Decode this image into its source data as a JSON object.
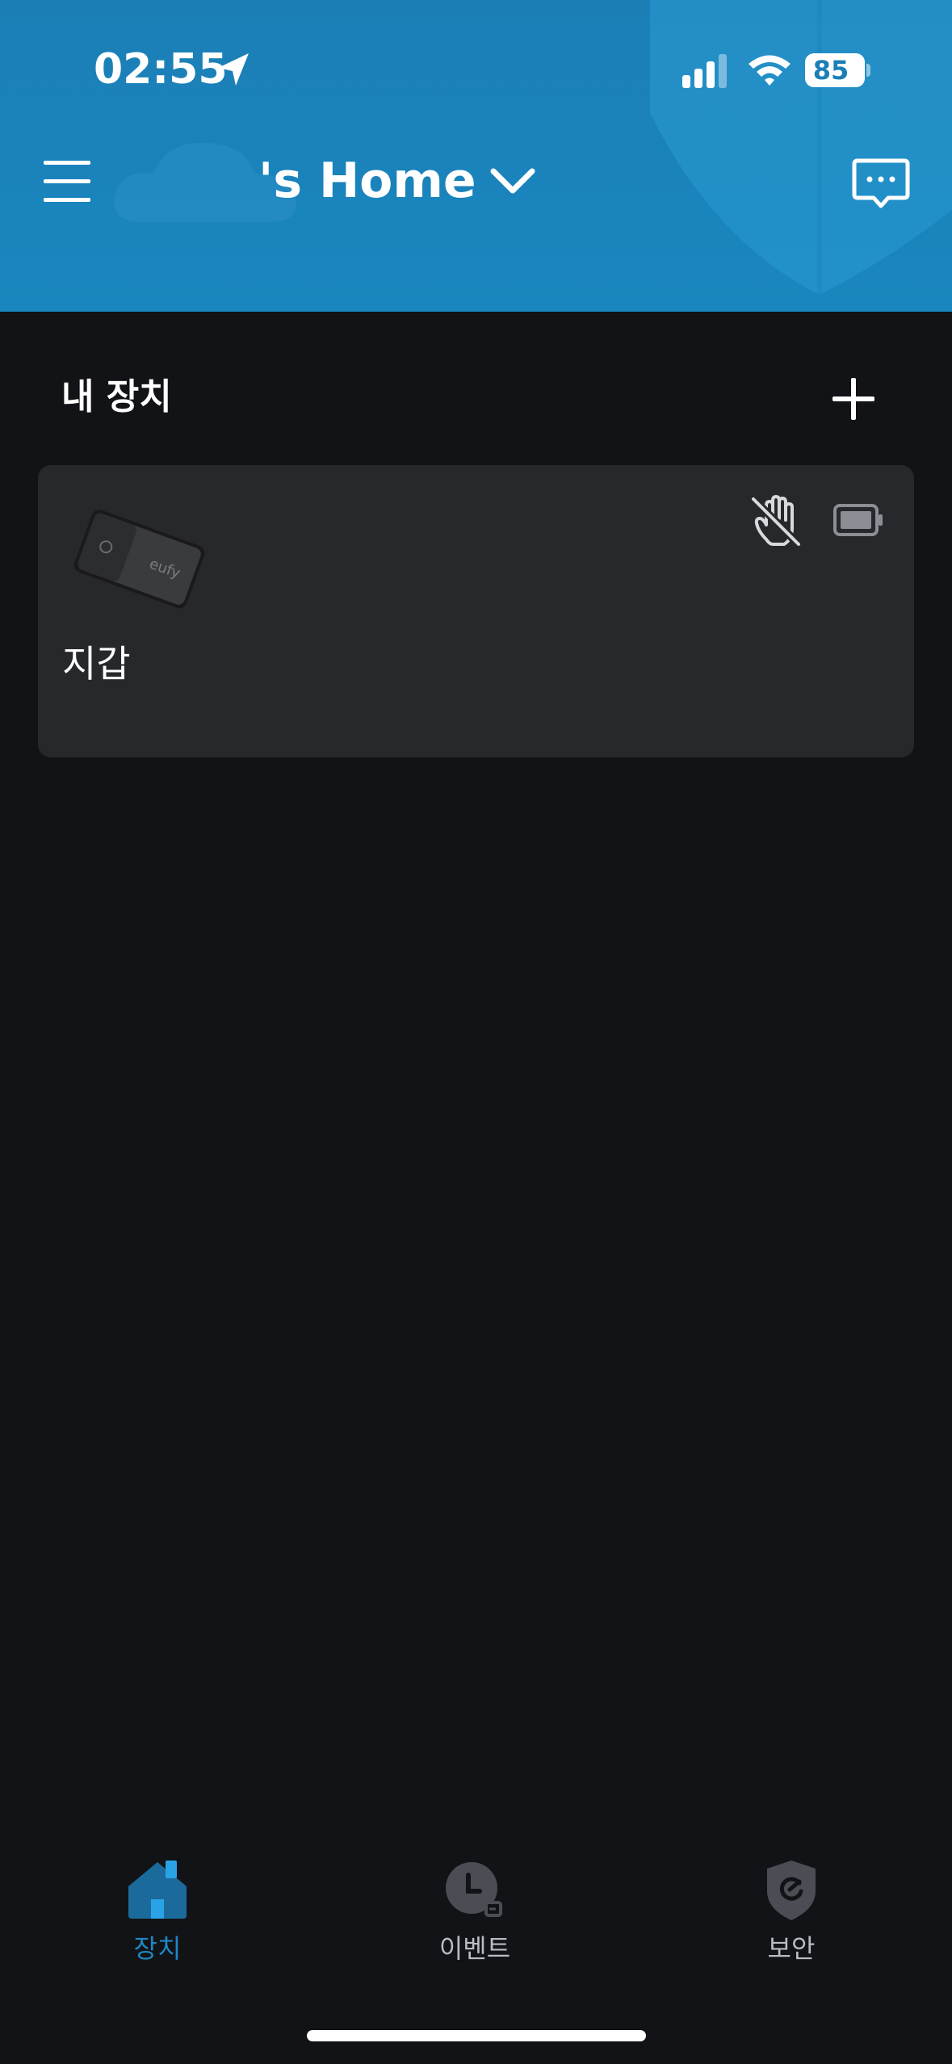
{
  "status_bar": {
    "time": "02:55",
    "battery_level": "85",
    "icons": [
      "location-arrow-icon",
      "cellular-signal-icon",
      "wifi-icon",
      "battery-icon"
    ]
  },
  "header": {
    "title": "'s Home",
    "icons": [
      "hamburger-menu-icon",
      "chevron-down-icon",
      "chat-bubble-icon"
    ]
  },
  "section": {
    "title": "내 장치",
    "add_icon": "plus-icon"
  },
  "devices": [
    {
      "name": "지갑",
      "image": "eufy-card-tracker",
      "status_icons": [
        "hand-off-icon",
        "battery-outline-icon"
      ]
    }
  ],
  "tabs": [
    {
      "label": "장치",
      "icon": "home-icon",
      "active": true
    },
    {
      "label": "이벤트",
      "icon": "clock-icon",
      "active": false
    },
    {
      "label": "보안",
      "icon": "shield-icon",
      "active": false
    }
  ],
  "colors": {
    "header_bg": "#1b7fb6",
    "page_bg": "#121316",
    "card_bg": "#26282c",
    "accent": "#1f87c4",
    "inactive": "#b8bcc3"
  }
}
